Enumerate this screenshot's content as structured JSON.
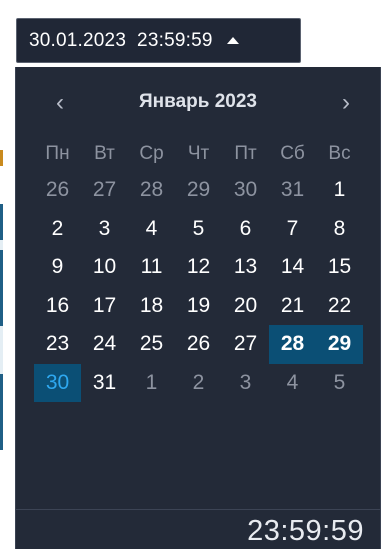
{
  "picker": {
    "value": "30.01.2023  23:59:59"
  },
  "calendar": {
    "month_title": "Январь 2023",
    "prev_glyph": "‹",
    "next_glyph": "›",
    "weekdays": [
      "Пн",
      "Вт",
      "Ср",
      "Чт",
      "Пт",
      "Сб",
      "Вс"
    ],
    "days": [
      {
        "label": "26",
        "state": "other"
      },
      {
        "label": "27",
        "state": "other"
      },
      {
        "label": "28",
        "state": "other"
      },
      {
        "label": "29",
        "state": "other"
      },
      {
        "label": "30",
        "state": "other"
      },
      {
        "label": "31",
        "state": "other"
      },
      {
        "label": "1",
        "state": "normal"
      },
      {
        "label": "2",
        "state": "normal"
      },
      {
        "label": "3",
        "state": "normal"
      },
      {
        "label": "4",
        "state": "normal"
      },
      {
        "label": "5",
        "state": "normal"
      },
      {
        "label": "6",
        "state": "normal"
      },
      {
        "label": "7",
        "state": "normal"
      },
      {
        "label": "8",
        "state": "normal"
      },
      {
        "label": "9",
        "state": "normal"
      },
      {
        "label": "10",
        "state": "normal"
      },
      {
        "label": "11",
        "state": "normal"
      },
      {
        "label": "12",
        "state": "normal"
      },
      {
        "label": "13",
        "state": "normal"
      },
      {
        "label": "14",
        "state": "normal"
      },
      {
        "label": "15",
        "state": "normal"
      },
      {
        "label": "16",
        "state": "normal"
      },
      {
        "label": "17",
        "state": "normal"
      },
      {
        "label": "18",
        "state": "normal"
      },
      {
        "label": "19",
        "state": "normal"
      },
      {
        "label": "20",
        "state": "normal"
      },
      {
        "label": "21",
        "state": "normal"
      },
      {
        "label": "22",
        "state": "normal"
      },
      {
        "label": "23",
        "state": "normal"
      },
      {
        "label": "24",
        "state": "normal"
      },
      {
        "label": "25",
        "state": "normal"
      },
      {
        "label": "26",
        "state": "normal"
      },
      {
        "label": "27",
        "state": "normal"
      },
      {
        "label": "28",
        "state": "sel"
      },
      {
        "label": "29",
        "state": "sel"
      },
      {
        "label": "30",
        "state": "today"
      },
      {
        "label": "31",
        "state": "normal"
      },
      {
        "label": "1",
        "state": "other"
      },
      {
        "label": "2",
        "state": "other"
      },
      {
        "label": "3",
        "state": "other"
      },
      {
        "label": "4",
        "state": "other"
      },
      {
        "label": "5",
        "state": "other"
      }
    ],
    "time": "23:59:59"
  },
  "colors": {
    "panel_bg": "#232a38",
    "selected_bg": "#0b4f75",
    "today_text": "#2ea8f0",
    "muted_text": "#8d93a0"
  }
}
